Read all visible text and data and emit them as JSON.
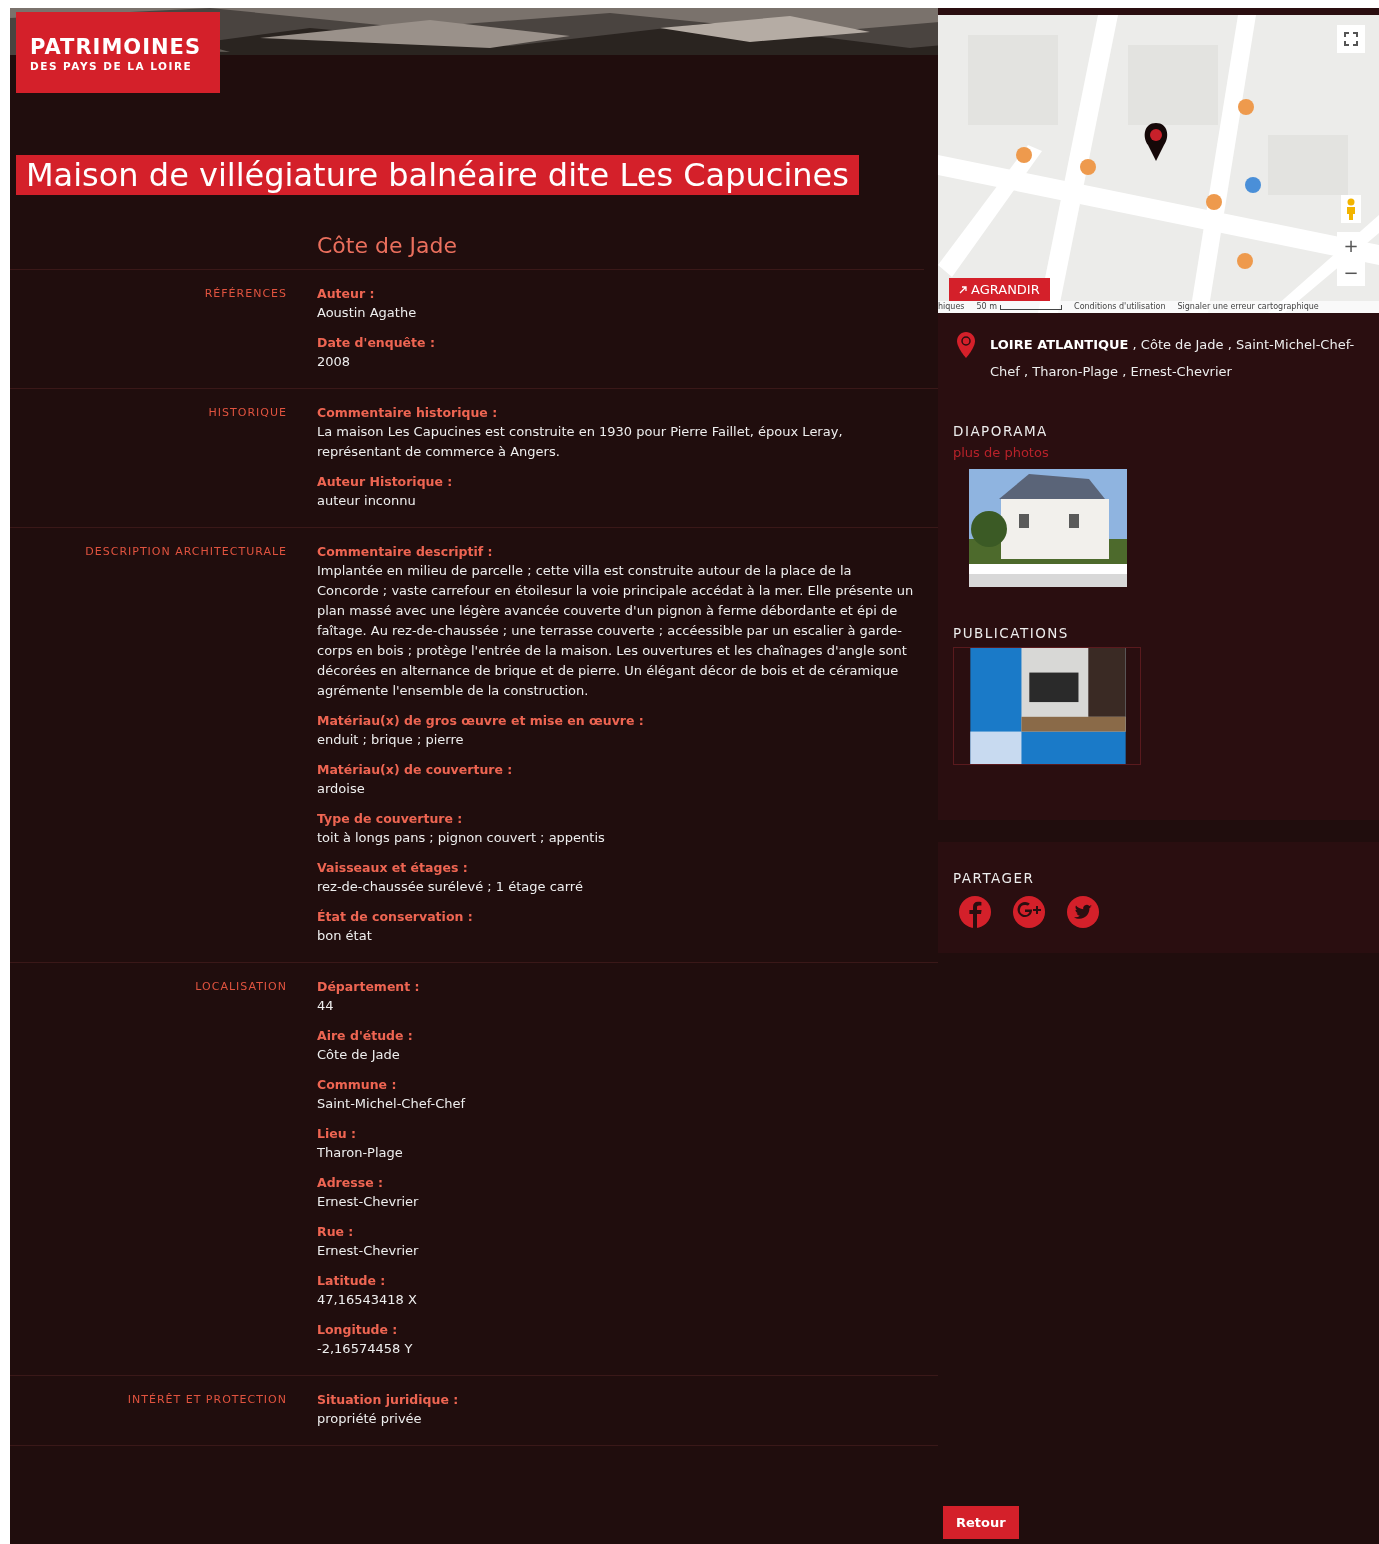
{
  "logo": {
    "line1": "PATRIMOINES",
    "line2": "DES PAYS DE LA LOIRE"
  },
  "title": "Maison de villégiature balnéaire dite Les Capucines",
  "subtitle": "Côte de Jade",
  "sections": [
    {
      "label": "RÉFÉRENCES",
      "fields": [
        {
          "label": "Auteur :",
          "value": "Aoustin Agathe"
        },
        {
          "label": "Date d'enquête :",
          "value": "2008"
        }
      ]
    },
    {
      "label": "HISTORIQUE",
      "fields": [
        {
          "label": "Commentaire historique :",
          "value": "La maison Les Capucines est construite en 1930 pour Pierre Faillet, époux Leray, représentant de commerce à Angers."
        },
        {
          "label": "Auteur Historique :",
          "value": "auteur inconnu"
        }
      ]
    },
    {
      "label": "DESCRIPTION ARCHITECTURALE",
      "fields": [
        {
          "label": "Commentaire descriptif :",
          "value": "Implantée en milieu de parcelle ; cette villa est construite autour de la place de la Concorde ; vaste carrefour en étoilesur la voie principale accédat à la mer. Elle présente un plan massé avec une légère avancée couverte d'un pignon à ferme débordante et épi de faîtage. Au rez-de-chaussée ; une terrasse couverte ; accéessible par un escalier à garde-corps en bois ; protège l'entrée de la maison. Les ouvertures et les chaînages d'angle sont décorées en alternance de brique et de pierre. Un élégant décor de bois et de céramique agrémente l'ensemble de la construction."
        },
        {
          "label": "Matériau(x) de gros œuvre et mise en œuvre :",
          "value": "enduit ; brique ; pierre"
        },
        {
          "label": "Matériau(x) de couverture :",
          "value": "ardoise"
        },
        {
          "label": "Type de couverture :",
          "value": "toit à longs pans ; pignon couvert ; appentis"
        },
        {
          "label": "Vaisseaux et étages :",
          "value": "rez-de-chaussée surélevé ; 1 étage carré"
        },
        {
          "label": "État de conservation :",
          "value": "bon état"
        }
      ]
    },
    {
      "label": "LOCALISATION",
      "fields": [
        {
          "label": "Département :",
          "value": "44"
        },
        {
          "label": "Aire d'étude :",
          "value": "Côte de Jade"
        },
        {
          "label": "Commune :",
          "value": "Saint-Michel-Chef-Chef"
        },
        {
          "label": "Lieu :",
          "value": "Tharon-Plage"
        },
        {
          "label": "Adresse :",
          "value": "Ernest-Chevrier"
        },
        {
          "label": "Rue :",
          "value": "Ernest-Chevrier"
        },
        {
          "label": "Latitude :",
          "value": "47,16543418 X"
        },
        {
          "label": "Longitude :",
          "value": "-2,16574458 Y"
        }
      ]
    },
    {
      "label": "INTÉRÊT ET PROTECTION",
      "fields": [
        {
          "label": "Situation juridique :",
          "value": "propriété privée"
        }
      ]
    }
  ],
  "map": {
    "kind": "picture",
    "expand_button": "AGRANDIR",
    "zoom_in": "+",
    "zoom_out": "−",
    "attribution": [
      "hiques",
      "50 m",
      "Conditions d'utilisation",
      "Signaler une erreur cartographique"
    ]
  },
  "location": "**LOIRE ATLANTIQUE** , Côte de Jade , Saint-Michel-Chef-Chef , Tharon-Plage , Ernest-Chevrier",
  "diaporama": {
    "title": "DIAPORAMA",
    "link": "plus de photos"
  },
  "publications": {
    "title": "PUBLICATIONS"
  },
  "share": {
    "title": "PARTAGER",
    "networks": [
      {
        "kind": "facebook"
      },
      {
        "kind": "googleplus"
      },
      {
        "kind": "twitter"
      }
    ]
  },
  "back_button": "Retour"
}
